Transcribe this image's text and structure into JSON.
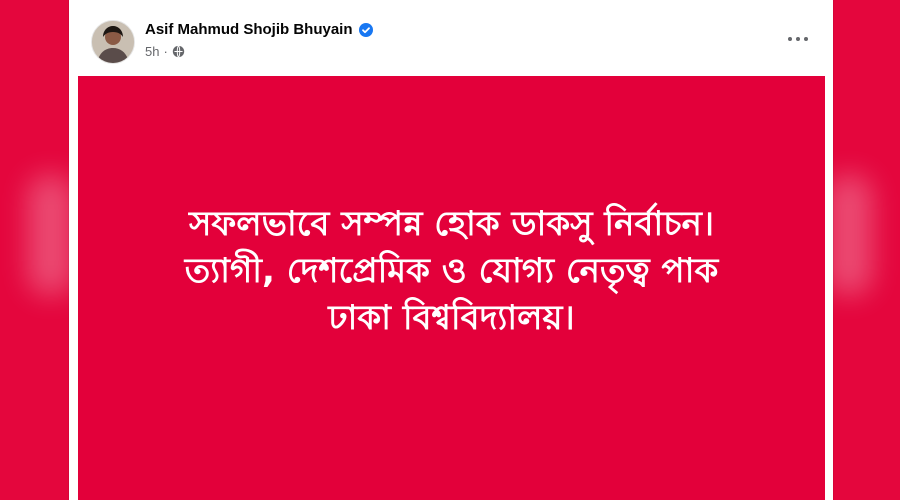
{
  "colors": {
    "background": "#e3003a",
    "card": "#ffffff",
    "name_text": "#050505",
    "meta_text": "#65676b",
    "verified_blue": "#1877f2",
    "post_bg": "#e3003a",
    "post_text": "#ffffff"
  },
  "post": {
    "author": "Asif Mahmud Shojib Bhuyain",
    "verified_icon": "verified-badge-icon",
    "time": "5h",
    "separator": "·",
    "audience_icon": "globe-icon",
    "more_icon": "more-options-icon",
    "image_lines": [
      "সফলভাবে সম্পন্ন হোক ডাকসু নির্বাচন।",
      "ত্যাগী, দেশপ্রেমিক ও যোগ্য নেতৃত্ব পাক",
      "ঢাকা বিশ্ববিদ্যালয়।"
    ]
  }
}
